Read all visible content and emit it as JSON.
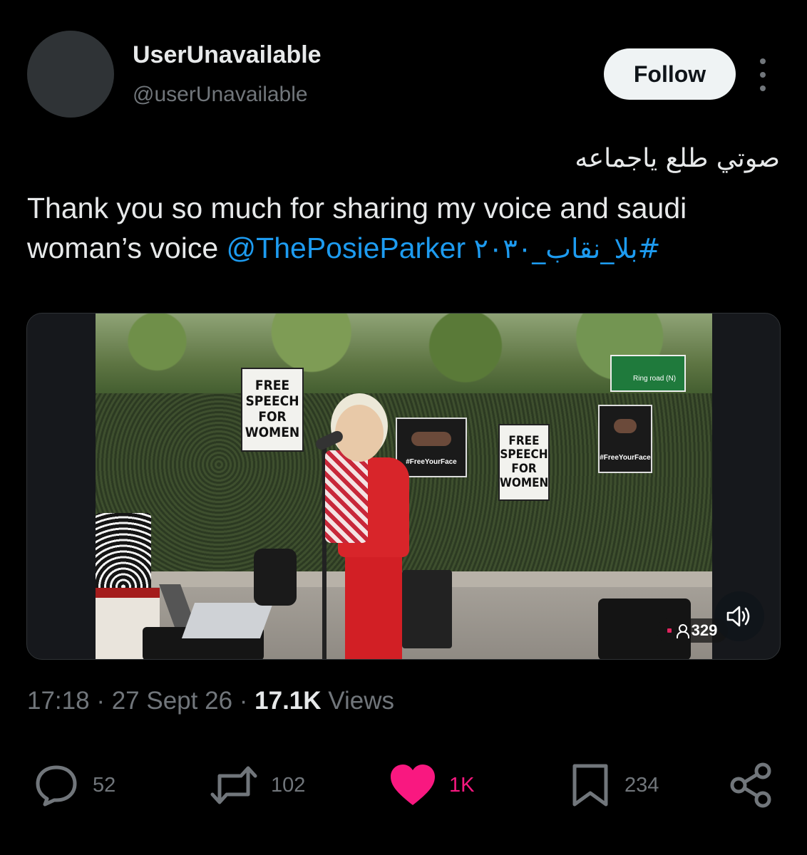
{
  "author": {
    "display_name": "UserUnavailable",
    "handle": "@userUnavailable"
  },
  "follow_label": "Follow",
  "tweet": {
    "arabic_line": "صوتي طلع ياجماعه",
    "text_part1": "Thank you so much for sharing my voice and saudi woman’s voice ",
    "mention": "@ThePosieParker",
    "hashtag": "#بلا_نقاب_٢٠٣٠"
  },
  "video": {
    "placard_text": [
      "FREE",
      "SPEECH",
      "FOR",
      "WOMEN"
    ],
    "poster_text": "#FreeYourFace",
    "road_sign": "Ring road (N)",
    "viewer_count": "329",
    "sound_icon": "speaker-sound-icon"
  },
  "meta": {
    "time": "17:18",
    "separator": "·",
    "date": "27 Sept 26",
    "views_count": "17.1K",
    "views_label": "Views"
  },
  "actions": {
    "replies": "52",
    "reposts": "102",
    "likes": "1K",
    "bookmarks": "234"
  },
  "colors": {
    "background": "#000000",
    "link": "#1d9bf0",
    "muted": "#71767b",
    "like": "#f91880"
  }
}
